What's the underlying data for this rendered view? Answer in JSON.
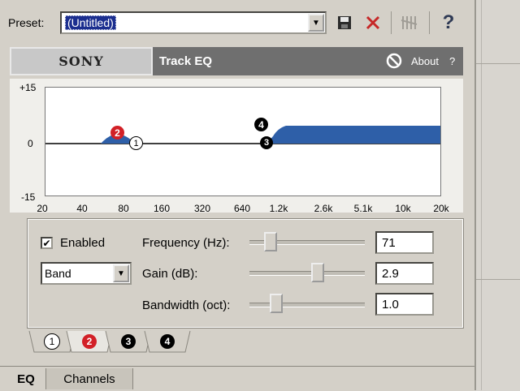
{
  "preset": {
    "label": "Preset:",
    "value": "(Untitled)"
  },
  "toolbar": {
    "save_icon": "save-icon",
    "delete_icon": "delete-icon",
    "bands_icon": "bands-icon",
    "help_label": "?"
  },
  "banner": {
    "brand": "SONY",
    "title": "Track EQ",
    "about_label": "About",
    "help_label": "?"
  },
  "graph": {
    "y_ticks": [
      "+15",
      "0",
      "-15"
    ],
    "x_ticks": [
      "20",
      "40",
      "80",
      "160",
      "320",
      "640",
      "1.2k",
      "2.6k",
      "5.1k",
      "10k",
      "20k"
    ],
    "band_markers": [
      "1",
      "2",
      "3",
      "4"
    ]
  },
  "band": {
    "enabled_label": "Enabled",
    "enabled": true,
    "type": "Band",
    "frequency_label": "Frequency (Hz):",
    "frequency_value": "71",
    "gain_label": "Gain (dB):",
    "gain_value": "2.9",
    "bandwidth_label": "Bandwidth (oct):",
    "bandwidth_value": "1.0"
  },
  "band_tabs": [
    "1",
    "2",
    "3",
    "4"
  ],
  "bottom_tabs": [
    "EQ",
    "Channels"
  ],
  "colors": {
    "accent_red": "#d22027",
    "curve_blue": "#2e5fa8",
    "selection": "#1b2e8f"
  }
}
